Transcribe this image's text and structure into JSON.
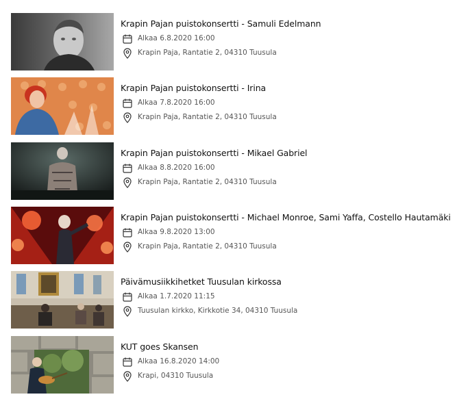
{
  "events": [
    {
      "title": "Krapin Pajan puistokonsertti - Samuli Edelmann",
      "date": "Alkaa 6.8.2020 16:00",
      "location": "Krapin Paja, Rantatie 2, 04310 Tuusula"
    },
    {
      "title": "Krapin Pajan puistokonsertti - Irina",
      "date": "Alkaa 7.8.2020 16:00",
      "location": "Krapin Paja, Rantatie 2, 04310 Tuusula"
    },
    {
      "title": "Krapin Pajan puistokonsertti - Mikael Gabriel",
      "date": "Alkaa 8.8.2020 16:00",
      "location": "Krapin Paja, Rantatie 2, 04310 Tuusula"
    },
    {
      "title": "Krapin Pajan puistokonsertti - Michael Monroe, Sami Yaffa, Costello Hautamäki",
      "date": "Alkaa 9.8.2020 13:00",
      "location": "Krapin Paja, Rantatie 2, 04310 Tuusula"
    },
    {
      "title": "Päivämusiikkihetket Tuusulan kirkossa",
      "date": "Alkaa 1.7.2020 11:15",
      "location": "Tuusulan kirkko, Kirkkotie 34, 04310 Tuusula"
    },
    {
      "title": "KUT goes Skansen",
      "date": "Alkaa 16.8.2020 14:00",
      "location": "Krapi, 04310 Tuusula"
    }
  ],
  "icons": {
    "date": "calendar-icon",
    "location": "map-pin-icon"
  },
  "colors": {
    "title": "#111111",
    "meta": "#555555",
    "icon": "#333333"
  }
}
